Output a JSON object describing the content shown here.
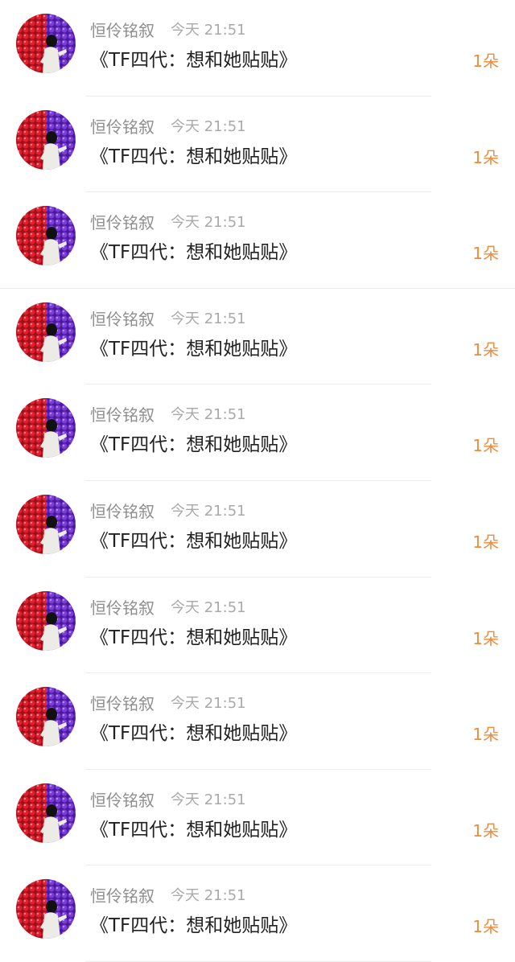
{
  "colors": {
    "name": "#8f8f8f",
    "time": "#a9a9a9",
    "title": "#222222",
    "count": "#f08a3c",
    "divider": "#ededed"
  },
  "avatar_icon": "red-purple-balloon-wall-photo",
  "items": [
    {
      "user": "恒伶铭叙",
      "time": "今天 21:51",
      "title": "《TF四代：想和她贴贴》",
      "count": "1朵"
    },
    {
      "user": "恒伶铭叙",
      "time": "今天 21:51",
      "title": "《TF四代：想和她贴贴》",
      "count": "1朵"
    },
    {
      "user": "恒伶铭叙",
      "time": "今天 21:51",
      "title": "《TF四代：想和她贴贴》",
      "count": "1朵"
    },
    {
      "user": "恒伶铭叙",
      "time": "今天 21:51",
      "title": "《TF四代：想和她贴贴》",
      "count": "1朵"
    },
    {
      "user": "恒伶铭叙",
      "time": "今天 21:51",
      "title": "《TF四代：想和她贴贴》",
      "count": "1朵"
    },
    {
      "user": "恒伶铭叙",
      "time": "今天 21:51",
      "title": "《TF四代：想和她贴贴》",
      "count": "1朵"
    },
    {
      "user": "恒伶铭叙",
      "time": "今天 21:51",
      "title": "《TF四代：想和她贴贴》",
      "count": "1朵"
    },
    {
      "user": "恒伶铭叙",
      "time": "今天 21:51",
      "title": "《TF四代：想和她贴贴》",
      "count": "1朵"
    },
    {
      "user": "恒伶铭叙",
      "time": "今天 21:51",
      "title": "《TF四代：想和她贴贴》",
      "count": "1朵"
    },
    {
      "user": "恒伶铭叙",
      "time": "今天 21:51",
      "title": "《TF四代：想和她贴贴》",
      "count": "1朵"
    }
  ]
}
